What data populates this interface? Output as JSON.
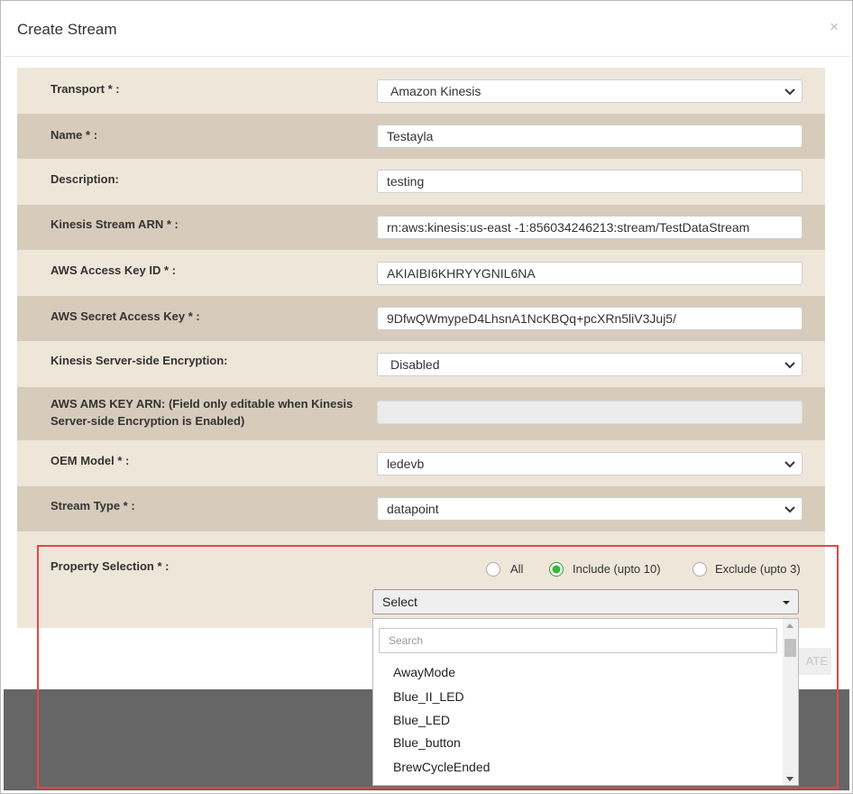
{
  "modal": {
    "title": "Create Stream",
    "close_symbol": "×"
  },
  "form": {
    "transport": {
      "label": "Transport * :",
      "value": "Amazon Kinesis"
    },
    "name": {
      "label": "Name * :",
      "value": "Testayla"
    },
    "description": {
      "label": "Description:",
      "value": "testing"
    },
    "kinesis_arn": {
      "label": "Kinesis Stream ARN * :",
      "value": "rn:aws:kinesis:us-east -1:856034246213:stream/TestDataStream"
    },
    "access_key": {
      "label": "AWS Access Key ID * :",
      "value": "AKIAIBI6KHRYYGNIL6NA"
    },
    "secret_key": {
      "label": "AWS Secret Access Key * :",
      "value": "9DfwQWmypeD4LhsnA1NcKBQq+pcXRn5liV3Juj5/"
    },
    "encryption": {
      "label": "Kinesis Server-side Encryption:",
      "value": "Disabled"
    },
    "ams_key": {
      "label_line1": "AWS AMS KEY ARN: (Field only editable when Kinesis",
      "label_line2": "Server-side Encryption is Enabled)",
      "value": ""
    },
    "oem_model": {
      "label": "OEM Model * :",
      "value": "ledevb"
    },
    "stream_type": {
      "label": "Stream Type * :",
      "value": "datapoint"
    },
    "property_selection": {
      "label": "Property Selection * :",
      "options": [
        "All",
        "Include (upto 10)",
        "Exclude (upto 3)"
      ],
      "selected": "Include (upto 10)",
      "select_value": "Select",
      "search_placeholder": "Search",
      "items": [
        "AwayMode",
        "Blue_II_LED",
        "Blue_LED",
        "Blue_button",
        "BrewCycleEnded"
      ]
    }
  },
  "footer": {
    "create_label": "ATE"
  },
  "colors": {
    "row_light": "#efe6da",
    "row_dark": "#d7ccbc",
    "radio_selected": "#3cb43c",
    "highlight": "#e84545"
  }
}
